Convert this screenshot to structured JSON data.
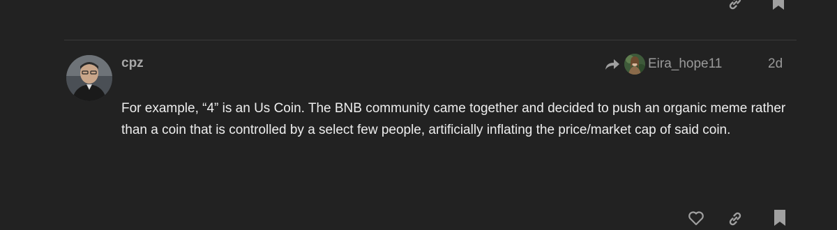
{
  "post": {
    "author": {
      "username": "cpz",
      "avatar_icon": "user-avatar-photo"
    },
    "reply_to": {
      "username": "Eira_hope11",
      "avatar_icon": "user-avatar-photo",
      "icon": "reply-arrow-icon"
    },
    "date": "2d",
    "body": "For example, “4” is an Us Coin. The BNB community came together and decided to push an organic meme rather than a coin that is controlled by a select few people, artificially inflating the price/market cap of said coin."
  },
  "actions": {
    "previous_post": [
      "link-icon",
      "bookmark-icon"
    ],
    "current_post": [
      "heart-icon",
      "link-icon",
      "bookmark-icon"
    ]
  },
  "colors": {
    "background": "#222222",
    "text": "#eeeeee",
    "muted": "#9a9a9a",
    "icon": "#a0a0a0",
    "divider": "#3a3a3a"
  }
}
